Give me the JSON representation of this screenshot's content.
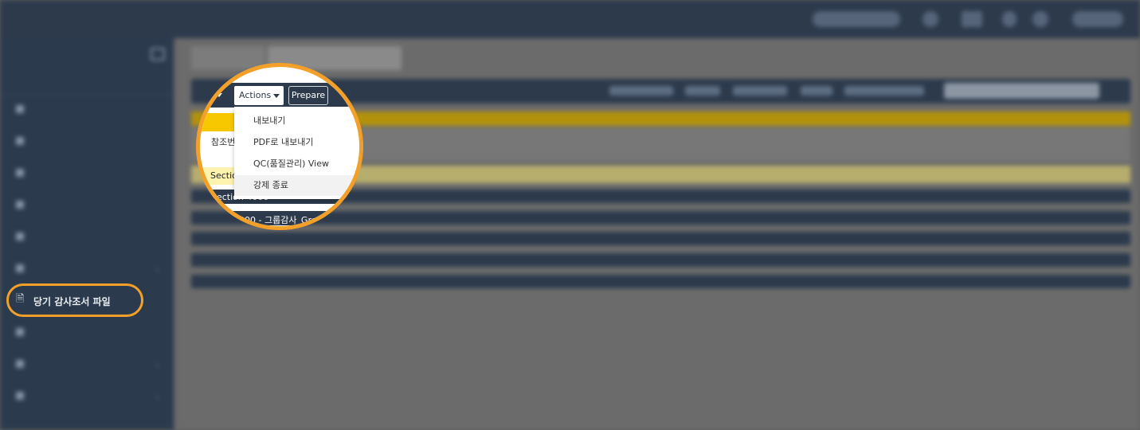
{
  "sidebar": {
    "active_item_label": "당기 감사조서 파일"
  },
  "toolbar": {
    "actions_label": "Actions",
    "prepare_label": "Prepare"
  },
  "actions_menu": {
    "items": [
      "내보내기",
      "PDF로 내보내기",
      "QC(품질관리) View",
      "강제 종료"
    ]
  },
  "table": {
    "ref_header_partial": "참조번",
    "section_label_partial": "Sectio",
    "row1_partial": "Section 4000 - ",
    "row2_partial": "7000 - 그룹감사_Gro"
  },
  "colors": {
    "accent_ring": "#f2a02a",
    "navy": "#2c3a4c",
    "yellow_header": "#f7c800",
    "light_yellow_row": "#fff3b0"
  }
}
